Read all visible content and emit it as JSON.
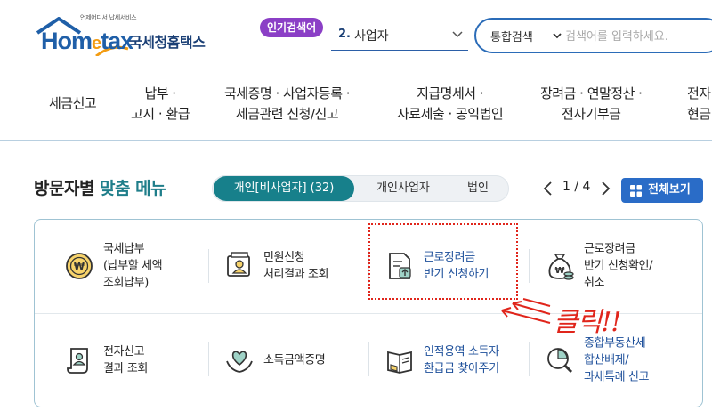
{
  "header": {
    "logo_tagline": "언제어디서 납세서비스",
    "logo_text_1": "Hom",
    "logo_text_e": "e",
    "logo_text_2": "tax",
    "logo_subtitle": "국세청홈택스",
    "popular_badge": "인기검색어",
    "popular_rank": "2.",
    "popular_term": "사업자",
    "search_scope": "통합검색",
    "search_placeholder": "검색어를 입력하세요."
  },
  "nav": [
    {
      "label": "세금신고"
    },
    {
      "label": "납부 ·\n고지 · 환급"
    },
    {
      "label": "국세증명 · 사업자등록 ·\n세금관련 신청/신고"
    },
    {
      "label": "지급명세서 ·\n자료제출 · 공익법인"
    },
    {
      "label": "장려금 · 연말정산 ·\n전자기부금"
    },
    {
      "label": "전자\n현금"
    }
  ],
  "visitor_menu": {
    "title_prefix": "방문자별 ",
    "title_accent": "맞춤 메뉴",
    "tabs": [
      {
        "label": "개인[비사업자] (32)",
        "active": true
      },
      {
        "label": "개인사업자",
        "active": false
      },
      {
        "label": "법인",
        "active": false
      }
    ],
    "pager_text": "1 / 4",
    "view_all": "전체보기"
  },
  "menu_items": [
    {
      "label": "국세납부\n(납부할 세액\n조회납부)",
      "icon": "coin-won-icon"
    },
    {
      "label": "민원신청\n처리결과 조회",
      "icon": "certificate-person-icon"
    },
    {
      "label": "근로장려금\n반기 신청하기",
      "icon": "document-upload-icon"
    },
    {
      "label": "근로장려금\n반기 신청확인/\n취소",
      "icon": "money-bag-icon"
    },
    {
      "label": "전자신고\n결과 조회",
      "icon": "scroll-person-icon"
    },
    {
      "label": "소득금액증명",
      "icon": "heart-hands-icon"
    },
    {
      "label": "인적용역 소득자\n환급금 찾아주기",
      "icon": "open-book-icon"
    },
    {
      "label": "종합부동산세\n합산배제/\n과세특례 신고",
      "icon": "magnifier-chart-icon"
    }
  ],
  "annotation": {
    "click_text": "클릭!!",
    "color": "#e0251b"
  },
  "colors": {
    "brand_blue": "#1f5fa8",
    "teal_active": "#17808b",
    "link_blue": "#1d4f9a",
    "badge_purple": "#8b3fc6",
    "view_all_blue": "#2a6cc7"
  }
}
